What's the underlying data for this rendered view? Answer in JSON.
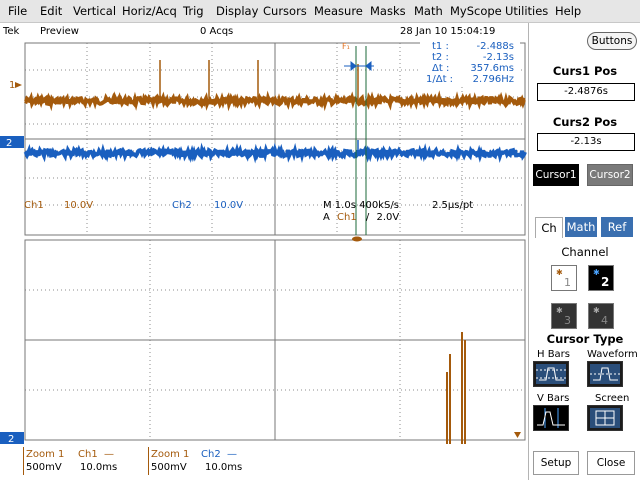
{
  "menu": [
    "File",
    "Edit",
    "Vertical",
    "Horiz/Acq",
    "Trig",
    "Display",
    "Cursors",
    "Measure",
    "Masks",
    "Math",
    "MyScope",
    "Utilities",
    "Help"
  ],
  "status": {
    "brand": "Tek",
    "mode": "Preview",
    "acqs": "0 Acqs",
    "datetime": "28 Jan 10 15:04:19"
  },
  "buttons_label": "Buttons",
  "cursor_readout": {
    "t1_label": "t1 :",
    "t1": "-2.488s",
    "t2_label": "t2 :",
    "t2": "-2.13s",
    "dt_label": "Δt :",
    "dt": "357.6ms",
    "inv_label": "1/Δt :",
    "inv": "2.796Hz"
  },
  "ch_info": {
    "ch1": "Ch1",
    "ch1_scale": "10.0V",
    "ch2": "Ch2",
    "ch2_scale": "10.0V",
    "timebase": "M 1.0s 400kS/s",
    "resolution": "2.5μs/pt",
    "trig_prefix": "A",
    "trig_ch": "Ch1",
    "trig_slope": "/",
    "trig_level": "2.0V"
  },
  "zoom_info": [
    {
      "zoom": "Zoom 1",
      "ch": "Ch1",
      "line": "—",
      "scale": "500mV",
      "time": "10.0ms"
    },
    {
      "zoom": "Zoom 1",
      "ch": "Ch2",
      "line": "—",
      "scale": "500mV",
      "time": "10.0ms"
    }
  ],
  "markers": {
    "ch1": "1",
    "ch2": "2",
    "zoom_ch2": "2"
  },
  "panel": {
    "curs1_title": "Curs1 Pos",
    "curs1_value": "-2.4876s",
    "curs2_title": "Curs2 Pos",
    "curs2_value": "-2.13s",
    "cursor1_btn": "Cursor1",
    "cursor2_btn": "Cursor2",
    "tabs": [
      "Ch",
      "Math",
      "Ref"
    ],
    "channel_label": "Channel",
    "channels": [
      "1",
      "2",
      "3",
      "4"
    ],
    "cursor_type_title": "Cursor Type",
    "types": [
      "H Bars",
      "Waveform",
      "V Bars",
      "Screen"
    ],
    "setup": "Setup",
    "close": "Close"
  },
  "colors": {
    "ch1": "#a45a0c",
    "ch2": "#1a5fbf",
    "cursor": "#1b6a3a",
    "grid": "#8c8c8c"
  }
}
